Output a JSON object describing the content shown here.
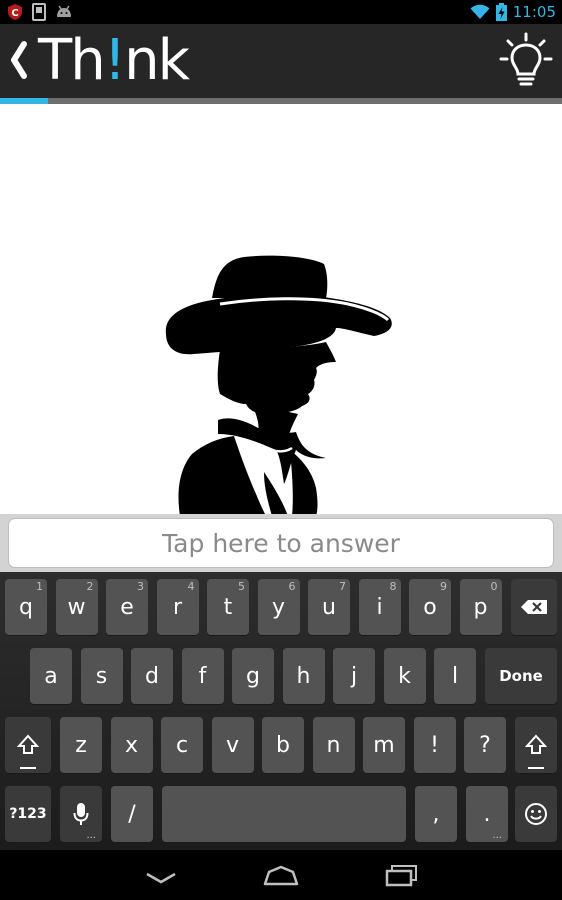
{
  "status_bar": {
    "time": "11:05",
    "icons": [
      "security-shield-icon",
      "sd-card-icon",
      "android-debug-icon",
      "wifi-icon",
      "battery-charging-icon"
    ]
  },
  "action_bar": {
    "title_prefix": "Th",
    "title_accent": "!",
    "title_suffix": "nk",
    "back_icon": "chevron-left-icon",
    "hint_icon": "lightbulb-icon"
  },
  "progress": {
    "fraction": 0.085,
    "color": "#33b5e5"
  },
  "puzzle": {
    "image": "cowboy-silhouette"
  },
  "answer": {
    "placeholder": "Tap here to answer",
    "value": ""
  },
  "keyboard": {
    "row1": [
      {
        "label": "q",
        "hint": "1"
      },
      {
        "label": "w",
        "hint": "2"
      },
      {
        "label": "e",
        "hint": "3"
      },
      {
        "label": "r",
        "hint": "4"
      },
      {
        "label": "t",
        "hint": "5"
      },
      {
        "label": "y",
        "hint": "6"
      },
      {
        "label": "u",
        "hint": "7"
      },
      {
        "label": "i",
        "hint": "8"
      },
      {
        "label": "o",
        "hint": "9"
      },
      {
        "label": "p",
        "hint": "0"
      }
    ],
    "row2": [
      "a",
      "s",
      "d",
      "f",
      "g",
      "h",
      "j",
      "k",
      "l"
    ],
    "row3": [
      "z",
      "x",
      "c",
      "v",
      "b",
      "n",
      "m",
      "!",
      "?"
    ],
    "done_label": "Done",
    "symbols_label": "?123",
    "slash_label": "/",
    "comma_label": ",",
    "period_label": ".",
    "key_dots": "..."
  },
  "nav_bar": {
    "icons": [
      "back-icon",
      "home-icon",
      "recents-icon"
    ]
  }
}
